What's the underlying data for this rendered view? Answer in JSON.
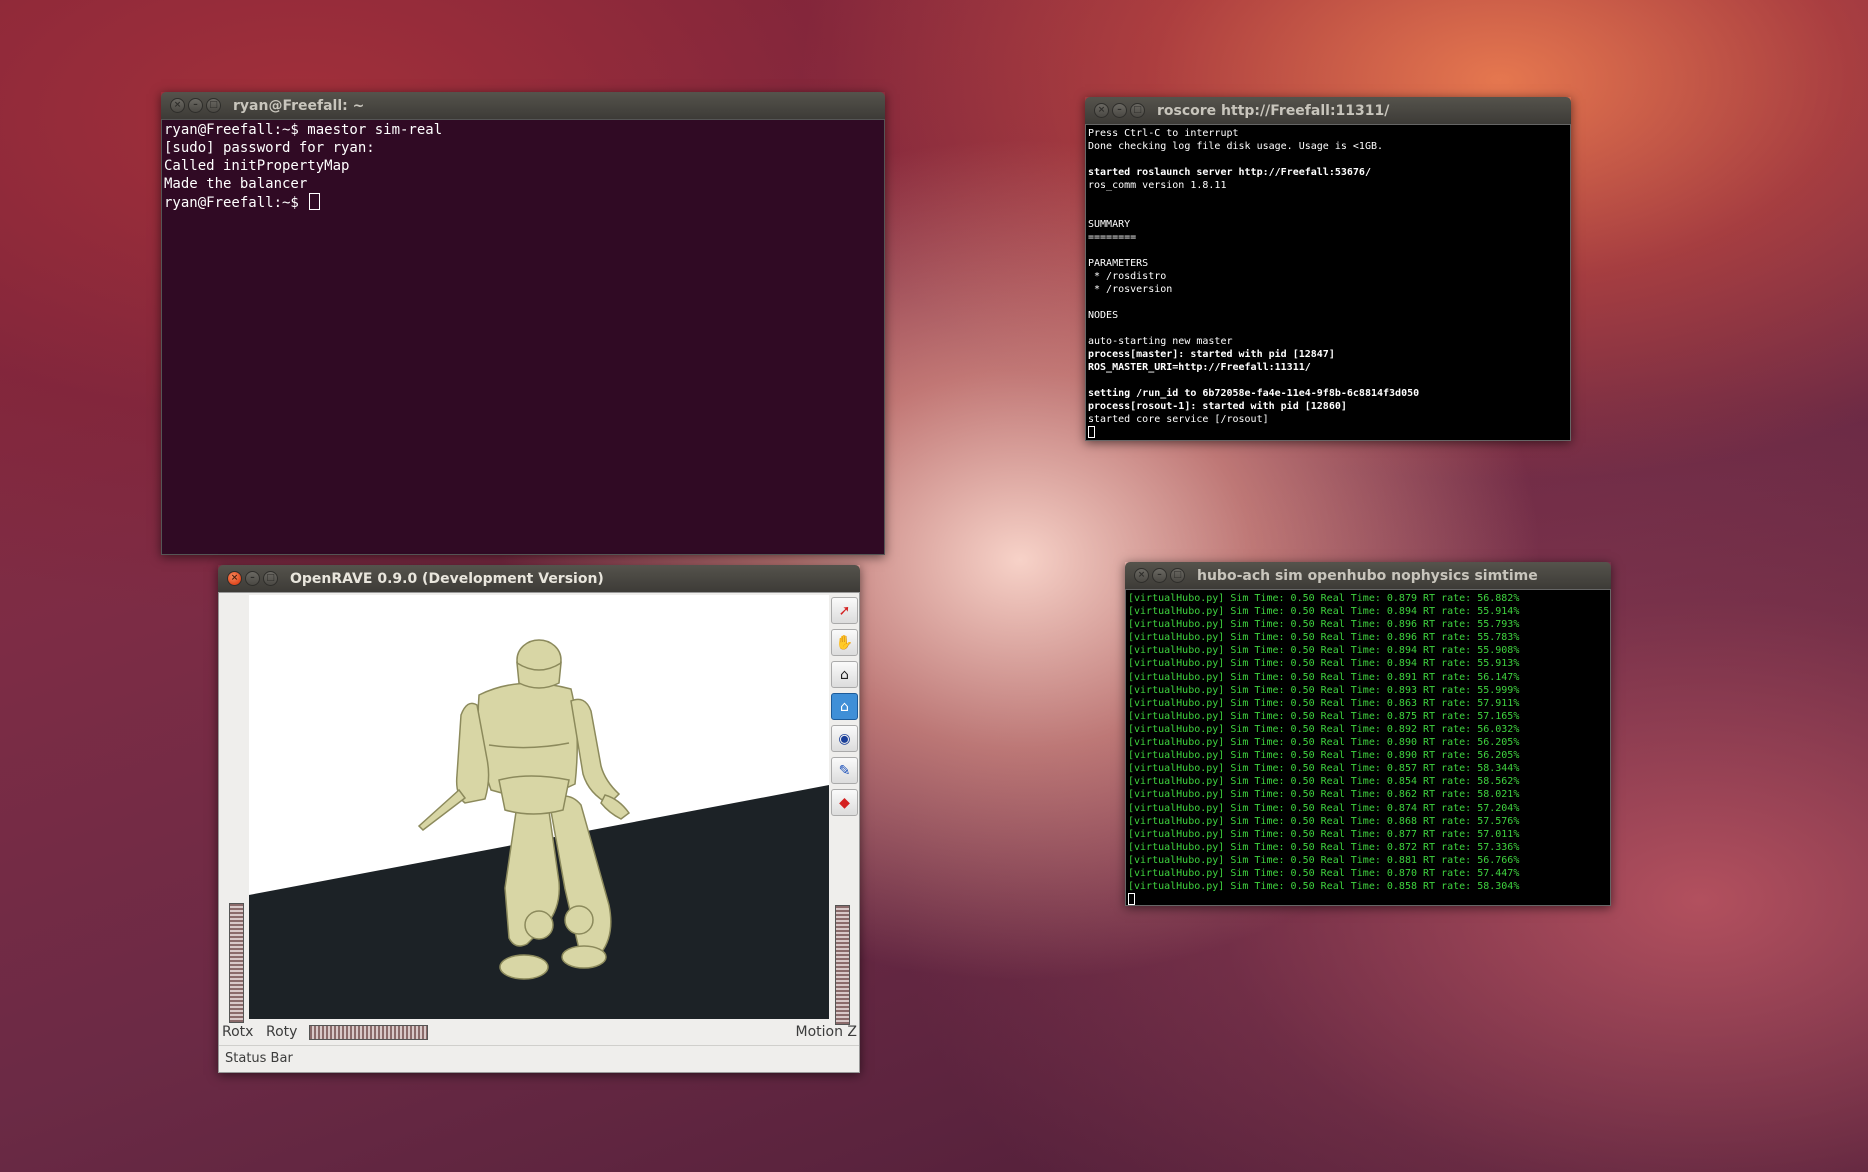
{
  "terminal_main": {
    "title": "ryan@Freefall: ~",
    "lines": [
      "ryan@Freefall:~$ maestor sim-real",
      "[sudo] password for ryan:",
      "Called initPropertyMap",
      "Made the balancer"
    ],
    "prompt": "ryan@Freefall:~$ "
  },
  "terminal_roscore": {
    "title": "roscore http://Freefall:11311/",
    "lines": [
      {
        "text": "Press Ctrl-C to interrupt",
        "bold": false
      },
      {
        "text": "Done checking log file disk usage. Usage is <1GB.",
        "bold": false
      },
      {
        "text": "",
        "bold": false
      },
      {
        "text": "started roslaunch server http://Freefall:53676/",
        "bold": true
      },
      {
        "text": "ros_comm version 1.8.11",
        "bold": false
      },
      {
        "text": "",
        "bold": false
      },
      {
        "text": "",
        "bold": false
      },
      {
        "text": "SUMMARY",
        "bold": false
      },
      {
        "text": "========",
        "bold": false
      },
      {
        "text": "",
        "bold": false
      },
      {
        "text": "PARAMETERS",
        "bold": false
      },
      {
        "text": " * /rosdistro",
        "bold": false
      },
      {
        "text": " * /rosversion",
        "bold": false
      },
      {
        "text": "",
        "bold": false
      },
      {
        "text": "NODES",
        "bold": false
      },
      {
        "text": "",
        "bold": false
      },
      {
        "text": "auto-starting new master",
        "bold": false
      },
      {
        "text": "process[master]: started with pid [12847]",
        "bold": true
      },
      {
        "text": "ROS_MASTER_URI=http://Freefall:11311/",
        "bold": true
      },
      {
        "text": "",
        "bold": false
      },
      {
        "text": "setting /run_id to 6b72058e-fa4e-11e4-9f8b-6c8814f3d050",
        "bold": true
      },
      {
        "text": "process[rosout-1]: started with pid [12860]",
        "bold": true
      },
      {
        "text": "started core service [/rosout]",
        "bold": false
      }
    ]
  },
  "terminal_hubo": {
    "title": "hubo-ach sim openhubo nophysics simtime",
    "lines": [
      "[virtualHubo.py] Sim Time: 0.50 Real Time: 0.879 RT rate: 56.882%",
      "[virtualHubo.py] Sim Time: 0.50 Real Time: 0.894 RT rate: 55.914%",
      "[virtualHubo.py] Sim Time: 0.50 Real Time: 0.896 RT rate: 55.793%",
      "[virtualHubo.py] Sim Time: 0.50 Real Time: 0.896 RT rate: 55.783%",
      "[virtualHubo.py] Sim Time: 0.50 Real Time: 0.894 RT rate: 55.908%",
      "[virtualHubo.py] Sim Time: 0.50 Real Time: 0.894 RT rate: 55.913%",
      "[virtualHubo.py] Sim Time: 0.50 Real Time: 0.891 RT rate: 56.147%",
      "[virtualHubo.py] Sim Time: 0.50 Real Time: 0.893 RT rate: 55.999%",
      "[virtualHubo.py] Sim Time: 0.50 Real Time: 0.863 RT rate: 57.911%",
      "[virtualHubo.py] Sim Time: 0.50 Real Time: 0.875 RT rate: 57.165%",
      "[virtualHubo.py] Sim Time: 0.50 Real Time: 0.892 RT rate: 56.032%",
      "[virtualHubo.py] Sim Time: 0.50 Real Time: 0.890 RT rate: 56.205%",
      "[virtualHubo.py] Sim Time: 0.50 Real Time: 0.890 RT rate: 56.205%",
      "[virtualHubo.py] Sim Time: 0.50 Real Time: 0.857 RT rate: 58.344%",
      "[virtualHubo.py] Sim Time: 0.50 Real Time: 0.854 RT rate: 58.562%",
      "[virtualHubo.py] Sim Time: 0.50 Real Time: 0.862 RT rate: 58.021%",
      "[virtualHubo.py] Sim Time: 0.50 Real Time: 0.874 RT rate: 57.204%",
      "[virtualHubo.py] Sim Time: 0.50 Real Time: 0.868 RT rate: 57.576%",
      "[virtualHubo.py] Sim Time: 0.50 Real Time: 0.877 RT rate: 57.011%",
      "[virtualHubo.py] Sim Time: 0.50 Real Time: 0.872 RT rate: 57.336%",
      "[virtualHubo.py] Sim Time: 0.50 Real Time: 0.881 RT rate: 56.766%",
      "[virtualHubo.py] Sim Time: 0.50 Real Time: 0.870 RT rate: 57.447%",
      "[virtualHubo.py] Sim Time: 0.50 Real Time: 0.858 RT rate: 58.304%"
    ]
  },
  "openrave": {
    "title": "OpenRAVE 0.9.0 (Development Version)",
    "tools": [
      {
        "name": "select-arrow-icon",
        "glyph": "➚",
        "color": "#d42020",
        "active": false
      },
      {
        "name": "hand-pan-icon",
        "glyph": "✋",
        "color": "#333333",
        "active": false
      },
      {
        "name": "camera-home-icon",
        "glyph": "⌂",
        "color": "#222222",
        "active": false
      },
      {
        "name": "view-home-icon",
        "glyph": "⌂",
        "color": "#ffffff",
        "active": true
      },
      {
        "name": "eye-view-icon",
        "glyph": "◉",
        "color": "#1a3f9a",
        "active": false
      },
      {
        "name": "brush-icon",
        "glyph": "✎",
        "color": "#1a4fba",
        "active": false
      },
      {
        "name": "collision-shape-icon",
        "glyph": "◆",
        "color": "#d42020",
        "active": false
      }
    ],
    "labels": {
      "rotx": "Rotx",
      "roty": "Roty",
      "motion_z": "Motion Z",
      "status_bar": "Status Bar"
    }
  }
}
